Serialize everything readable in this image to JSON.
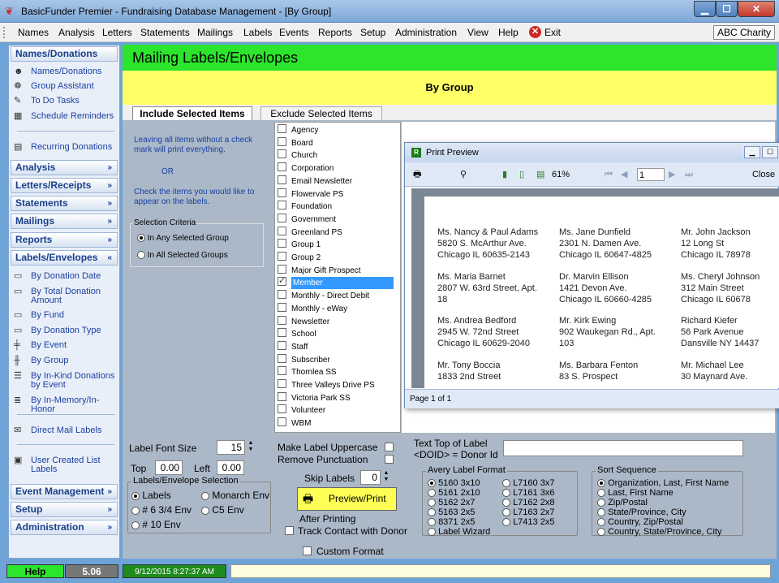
{
  "window": {
    "title": "BasicFunder Premier - Fundraising Database Management - [By Group]"
  },
  "menu": {
    "items": [
      "Names",
      "Analysis",
      "Letters",
      "Statements",
      "Mailings",
      "Labels",
      "Events",
      "Reports",
      "Setup",
      "Administration",
      "View",
      "Help"
    ],
    "exit": "Exit",
    "charity": "ABC Charity"
  },
  "sidebar": {
    "names_header": "Names/Donations",
    "names_items": [
      "Names/Donations",
      "Group Assistant",
      "To Do Tasks",
      "Schedule Reminders"
    ],
    "recurring": "Recurring Donations",
    "collapsed1": [
      "Analysis",
      "Letters/Receipts",
      "Statements",
      "Mailings",
      "Reports"
    ],
    "labels_header": "Labels/Envelopes",
    "labels_items": [
      "By Donation Date",
      "By Total Donation Amount",
      "By Fund",
      "By Donation Type",
      "By Event",
      "By Group",
      "By In-Kind Donations by Event",
      "By In-Memory/In-Honor"
    ],
    "direct_mail": "Direct Mail Labels",
    "user_created": "User Created List Labels",
    "collapsed2": [
      "Event Management",
      "Setup",
      "Administration"
    ]
  },
  "main": {
    "banner": "Mailing Labels/Envelopes",
    "subbanner": "By Group",
    "tabs": [
      "Include Selected Items",
      "Exclude Selected Items"
    ],
    "instructions": {
      "line1": "Leaving all items without a check mark will print everything.",
      "or": "OR",
      "line2": "Check the items you would like to appear on the labels."
    },
    "criteria": {
      "legend": "Selection Criteria",
      "any": "In Any Selected Group",
      "all": "In All Selected Groups"
    },
    "groups": [
      "Agency",
      "Board",
      "Church",
      "Corporation",
      "Email Newsletter",
      "Flowervale PS",
      "Foundation",
      "Government",
      "Greenland PS",
      "Group 1",
      "Group 2",
      "Major Gift Prospect",
      "Member",
      "Monthly - Direct Debit",
      "Monthly - eWay",
      "Newsletter",
      "School",
      "Staff",
      "Subscriber",
      "Thornlea SS",
      "Three Valleys Drive PS",
      "Victoria Park SS",
      "Volunteer",
      "WBM"
    ],
    "selected_group": "Member"
  },
  "bottom": {
    "font_size_label": "Label Font Size",
    "font_size": "15",
    "top_label": "Top",
    "top_value": "0.00",
    "left_label": "Left",
    "left_value": "0.00",
    "uppercase": "Make Label Uppercase",
    "remove_punct": "Remove Punctuation",
    "skip_label": "Skip Labels",
    "skip_value": "0",
    "text_top_label": "Text Top of Label",
    "doid": "<DOID> = Donor Id",
    "env_legend": "Labels/Envelope Selection",
    "env_opts": [
      "Labels",
      "Monarch Env",
      "# 6 3/4 Env",
      "C5 Env",
      "# 10 Env"
    ],
    "preview_btn": "Preview/Print",
    "after_printing": "After Printing",
    "track_contact": "Track Contact with Donor",
    "custom_format": "Custom Format",
    "avery_legend": "Avery Label Format",
    "avery_left": [
      "5160  3x10",
      "5161  2x10",
      "5162  2x7",
      "5163  2x5",
      "8371  2x5"
    ],
    "avery_right": [
      "L7160 3x7",
      "L7161 3x6",
      "L7162 2x8",
      "L7163 2x7",
      "L7413 2x5"
    ],
    "label_wizard": "Label Wizard",
    "sort_legend": "Sort Sequence",
    "sort_opts": [
      "Organization, Last, First Name",
      "Last, First Name",
      "Zip/Postal",
      "State/Province, City",
      "Country, Zip/Postal",
      "Country, State/Province, City"
    ]
  },
  "status": {
    "help": "Help",
    "version": "5.06",
    "datetime": "9/12/2015 8:27:37 AM"
  },
  "preview": {
    "title": "Print Preview",
    "zoom": "61%",
    "page_input": "1",
    "close": "Close",
    "status": "Page 1 of 1",
    "labels": [
      [
        "Ms. Nancy & Paul Adams",
        "5820 S. McArthur Ave.",
        "Chicago IL 60635-2143"
      ],
      [
        "Ms. Jane Dunfield",
        "2301 N. Damen Ave.",
        "Chicago IL 60647-4825"
      ],
      [
        "Mr. John Jackson",
        "12 Long St",
        "Chicago IL 78978"
      ],
      [
        "Ms. Maria Barnet",
        "2807 W. 63rd Street, Apt.",
        "18"
      ],
      [
        "Dr. Marvin Ellison",
        "1421 Devon Ave.",
        "Chicago IL 60660-4285"
      ],
      [
        "Ms. Cheryl Johnson",
        "312 Main Street",
        "Chicago IL 60678"
      ],
      [
        "Ms. Andrea Bedford",
        "2945 W. 72nd Street",
        "Chicago IL 60629-2040"
      ],
      [
        "Mr. Kirk Ewing",
        "902 Waukegan Rd., Apt.",
        "103"
      ],
      [
        "Richard Kiefer",
        "56 Park Avenue",
        "Dansville NY 14437"
      ],
      [
        "Mr. Tony Boccia",
        "1833 2nd Street",
        ""
      ],
      [
        "Ms. Barbara Fenton",
        "83 S. Prospect",
        ""
      ],
      [
        "Mr. Michael Lee",
        "30 Maynard Ave.",
        ""
      ]
    ]
  },
  "colors": {
    "banner": "#2ce52c",
    "subbanner": "#ffff66",
    "accent": "#1a3fa0"
  }
}
